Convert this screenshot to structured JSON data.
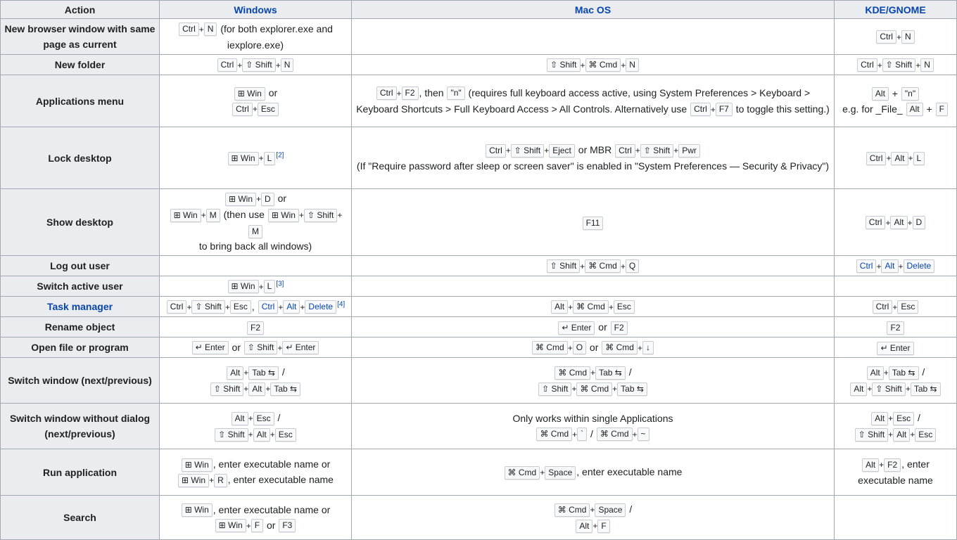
{
  "headers": {
    "action": "Action",
    "windows": "Windows",
    "macos": "Mac OS",
    "kde": "KDE/GNOME"
  },
  "rows": [
    {
      "name": "New browser window with same page as current",
      "windows": [
        [
          [
            "Ctrl",
            "N"
          ]
        ],
        " (for both explorer.exe and iexplore.exe)"
      ],
      "mac": [],
      "kde": [
        [
          [
            "Ctrl",
            "N"
          ]
        ]
      ]
    },
    {
      "name": "New folder",
      "windows": [
        [
          [
            "Ctrl",
            "⇧ Shift",
            "N"
          ]
        ]
      ],
      "mac": [
        [
          [
            "⇧ Shift",
            "⌘ Cmd",
            "N"
          ]
        ]
      ],
      "kde": [
        [
          [
            "Ctrl",
            "⇧ Shift",
            "N"
          ]
        ]
      ]
    },
    {
      "name": "Applications menu",
      "windows": [
        [
          [
            "⊞ Win"
          ]
        ],
        " or",
        "\n",
        [
          [
            "Ctrl",
            "Esc"
          ]
        ]
      ],
      "mac": [
        [
          [
            "Ctrl",
            "F2"
          ]
        ],
        ", then ",
        [
          [
            "\"n\""
          ]
        ],
        " (requires full keyboard access active, using System Preferences > Keyboard > Keyboard Shortcuts > Full Keyboard Access > All Controls. Alternatively use ",
        [
          [
            "Ctrl",
            "F7"
          ]
        ],
        " to toggle this setting.)"
      ],
      "kde": [
        [
          [
            "Alt"
          ]
        ],
        " + ",
        [
          [
            "\"n\""
          ]
        ],
        "\n",
        "e.g. for _File_ ",
        [
          [
            "Alt"
          ]
        ],
        " + ",
        [
          [
            "F"
          ]
        ]
      ]
    },
    {
      "name": "Lock desktop",
      "windows": [
        [
          [
            "⊞ Win",
            "L"
          ]
        ],
        {
          "ref": "[2]"
        }
      ],
      "mac": [
        [
          [
            "Ctrl",
            "⇧ Shift",
            "Eject"
          ]
        ],
        " or MBR ",
        [
          [
            "Ctrl",
            "⇧ Shift",
            "Pwr"
          ]
        ],
        "\n",
        "(If \"Require password after sleep or screen saver\" is enabled in \"System Preferences — Security & Privacy\")"
      ],
      "kde": [
        [
          [
            "Ctrl",
            "Alt",
            "L"
          ]
        ]
      ]
    },
    {
      "name": "Show desktop",
      "windows": [
        [
          [
            "⊞ Win",
            "D"
          ]
        ],
        " or",
        "\n",
        [
          [
            "⊞ Win",
            "M"
          ]
        ],
        " (then use ",
        [
          [
            "⊞ Win",
            "⇧ Shift",
            "M"
          ]
        ],
        "\n",
        "to bring back all windows)"
      ],
      "mac": [
        [
          [
            "F11"
          ]
        ]
      ],
      "kde": [
        [
          [
            "Ctrl",
            "Alt",
            "D"
          ]
        ]
      ]
    },
    {
      "name": "Log out user",
      "windows": [],
      "mac": [
        [
          [
            "⇧ Shift",
            "⌘ Cmd",
            "Q"
          ]
        ]
      ],
      "kde": [
        {
          "blue": [
            "Ctrl",
            "Alt",
            "Delete"
          ]
        }
      ]
    },
    {
      "name": "Switch active user",
      "windows": [
        [
          [
            "⊞ Win",
            "L"
          ]
        ],
        {
          "ref": "[3]"
        }
      ],
      "mac": [],
      "kde": []
    },
    {
      "name": "Task manager",
      "link": true,
      "windows": [
        [
          [
            "Ctrl",
            "⇧ Shift",
            "Esc"
          ]
        ],
        ", ",
        {
          "blue": [
            "Ctrl",
            "Alt",
            "Delete"
          ]
        },
        {
          "ref": "[4]"
        }
      ],
      "mac": [
        [
          [
            "Alt",
            "⌘ Cmd",
            "Esc"
          ]
        ]
      ],
      "kde": [
        [
          [
            "Ctrl",
            "Esc"
          ]
        ]
      ]
    },
    {
      "name": "Rename object",
      "windows": [
        [
          [
            "F2"
          ]
        ]
      ],
      "mac": [
        [
          [
            "↵ Enter"
          ]
        ],
        " or ",
        [
          [
            "F2"
          ]
        ]
      ],
      "kde": [
        [
          [
            "F2"
          ]
        ]
      ]
    },
    {
      "name": "Open file or program",
      "windows": [
        [
          [
            "↵ Enter"
          ]
        ],
        " or ",
        [
          [
            "⇧ Shift",
            "↵ Enter"
          ]
        ]
      ],
      "mac": [
        [
          [
            "⌘ Cmd",
            "O"
          ]
        ],
        " or ",
        [
          [
            "⌘ Cmd",
            "↓"
          ]
        ]
      ],
      "kde": [
        [
          [
            "↵ Enter"
          ]
        ]
      ]
    },
    {
      "name": "Switch window (next/previous)",
      "windows": [
        [
          [
            "Alt",
            "Tab ⇆"
          ]
        ],
        " /",
        "\n",
        [
          [
            "⇧ Shift",
            "Alt",
            "Tab ⇆"
          ]
        ]
      ],
      "mac": [
        [
          [
            "⌘ Cmd",
            "Tab ⇆"
          ]
        ],
        " /",
        "\n",
        [
          [
            "⇧ Shift",
            "⌘ Cmd",
            "Tab ⇆"
          ]
        ]
      ],
      "kde": [
        [
          [
            "Alt",
            "Tab ⇆"
          ]
        ],
        " /",
        "\n",
        [
          [
            "Alt",
            "⇧ Shift",
            "Tab ⇆"
          ]
        ]
      ]
    },
    {
      "name": "Switch window without dialog (next/previous)",
      "windows": [
        [
          [
            "Alt",
            "Esc"
          ]
        ],
        " /",
        "\n",
        [
          [
            "⇧ Shift",
            "Alt",
            "Esc"
          ]
        ]
      ],
      "mac": [
        "Only works within single Applications",
        "\n",
        [
          [
            "⌘ Cmd",
            "`"
          ]
        ],
        " / ",
        [
          [
            "⌘ Cmd",
            "~"
          ]
        ]
      ],
      "kde": [
        [
          [
            "Alt",
            "Esc"
          ]
        ],
        " /",
        "\n",
        [
          [
            "⇧ Shift",
            "Alt",
            "Esc"
          ]
        ]
      ]
    },
    {
      "name": "Run application",
      "windows": [
        [
          [
            "⊞ Win"
          ]
        ],
        ", enter executable name or",
        "\n",
        [
          [
            "⊞ Win",
            "R"
          ]
        ],
        ", enter executable name"
      ],
      "mac": [
        [
          [
            "⌘ Cmd",
            "Space"
          ]
        ],
        ", enter executable name"
      ],
      "kde": [
        [
          [
            "Alt",
            "F2"
          ]
        ],
        ", enter executable name"
      ]
    },
    {
      "name": "Search",
      "windows": [
        [
          [
            "⊞ Win"
          ]
        ],
        ", enter executable name or",
        "\n",
        [
          [
            "⊞ Win",
            "F"
          ]
        ],
        " or ",
        [
          [
            "F3"
          ]
        ]
      ],
      "mac": [
        [
          [
            "⌘ Cmd",
            "Space"
          ]
        ],
        " /",
        "\n",
        [
          [
            "Alt",
            "F"
          ]
        ]
      ],
      "kde": []
    }
  ]
}
